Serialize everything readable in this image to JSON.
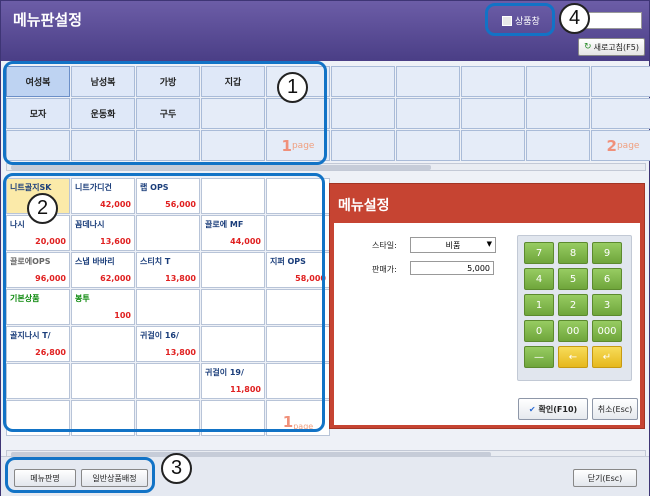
{
  "window": {
    "title": "메뉴판설정"
  },
  "titlebar": {
    "checkbox_label": "상품창",
    "refresh_label": "새로고침(F5)"
  },
  "categories": [
    "여성복",
    "남성복",
    "가방",
    "지갑",
    "모자",
    "운동화",
    "구두"
  ],
  "category_pages": [
    {
      "number": "1",
      "suffix": "page"
    },
    {
      "number": "2",
      "suffix": "page"
    }
  ],
  "products": [
    {
      "name": "니트골지SK",
      "price": ""
    },
    {
      "name": "니트가디건",
      "price": "42,000"
    },
    {
      "name": "랩 OPS",
      "price": "56,000"
    },
    {
      "name": "나시",
      "price": "20,000"
    },
    {
      "name": "꼼데나시",
      "price": "13,600"
    },
    {
      "name": "끌로에 MF",
      "price": "44,000"
    },
    {
      "name": "끌로에OPS",
      "price": "96,000"
    },
    {
      "name": "스냅 바바리",
      "price": "62,000"
    },
    {
      "name": "스티치 T",
      "price": "13,800"
    },
    {
      "name": "지퍼 OPS",
      "price": "58,000"
    },
    {
      "name": "기본상품",
      "price": ""
    },
    {
      "name": "봉투",
      "price": "100"
    },
    {
      "name": "골지나시 T/",
      "price": "26,800"
    },
    {
      "name": "귀걸이 16/",
      "price": "13,800"
    },
    {
      "name": "귀걸이 19/",
      "price": "11,800"
    }
  ],
  "product_page": {
    "number": "1",
    "suffix": "page"
  },
  "menu_panel": {
    "title": "메뉴설정",
    "style_label": "스타일:",
    "style_value": "비품",
    "price_label": "판매가:",
    "price_value": "5,000",
    "keypad": [
      "7",
      "8",
      "9",
      "4",
      "5",
      "6",
      "1",
      "2",
      "3",
      "0",
      "00",
      "000",
      "—",
      "←",
      "↵"
    ],
    "confirm_label": "확인(F10)",
    "cancel_label": "취소(Esc)"
  },
  "bottom": {
    "menu_name_label": "메뉴판명",
    "assign_label": "일반상품배정",
    "close_label": "닫기(Esc)"
  },
  "annotations": [
    "1",
    "2",
    "3",
    "4"
  ],
  "colors": {
    "title_bar": "#5a4d95",
    "panel": "#c64432",
    "keypad_green": "#7fb648",
    "keypad_yellow": "#efc83a",
    "annotation": "#1273c6",
    "price": "#e02020"
  }
}
